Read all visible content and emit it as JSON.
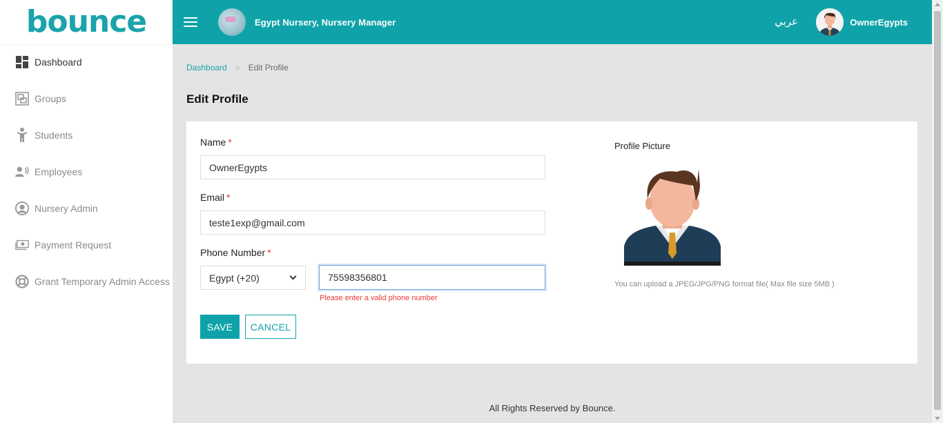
{
  "brand": {
    "logo_text": "bounce",
    "accent_color": "#0fa3a9"
  },
  "sidebar": {
    "items": [
      {
        "label": "Dashboard",
        "icon": "dashboard-icon",
        "active": true
      },
      {
        "label": "Groups",
        "icon": "groups-icon",
        "active": false
      },
      {
        "label": "Students",
        "icon": "student-icon",
        "active": false
      },
      {
        "label": "Employees",
        "icon": "employees-icon",
        "active": false
      },
      {
        "label": "Nursery Admin",
        "icon": "user-circle-icon",
        "active": false
      },
      {
        "label": "Payment Request",
        "icon": "money-icon",
        "active": false
      },
      {
        "label": "Grant Temporary Admin Access",
        "icon": "lifebuoy-icon",
        "active": false
      }
    ]
  },
  "topbar": {
    "org_name": "Egypt Nursery, Nursery Manager",
    "language_toggle": "عربي",
    "user_name": "OwnerEgypts"
  },
  "breadcrumb": {
    "home": "Dashboard",
    "current": "Edit Profile"
  },
  "page": {
    "title": "Edit Profile"
  },
  "form": {
    "name_label": "Name",
    "name_value": "OwnerEgypts",
    "email_label": "Email",
    "email_value": "teste1exp@gmail.com",
    "phone_label": "Phone Number",
    "country_code_value": "Egypt (+20)",
    "phone_value": "75598356801",
    "phone_error": "Please enter a valid phone number",
    "required_mark": "*",
    "save_label": "SAVE",
    "cancel_label": "CANCEL",
    "profile_picture_label": "Profile Picture",
    "profile_picture_hint": "You can upload a JPEG/JPG/PNG format file( Max file size 5MB )"
  },
  "footer": {
    "text": "All Rights Reserved by Bounce."
  }
}
